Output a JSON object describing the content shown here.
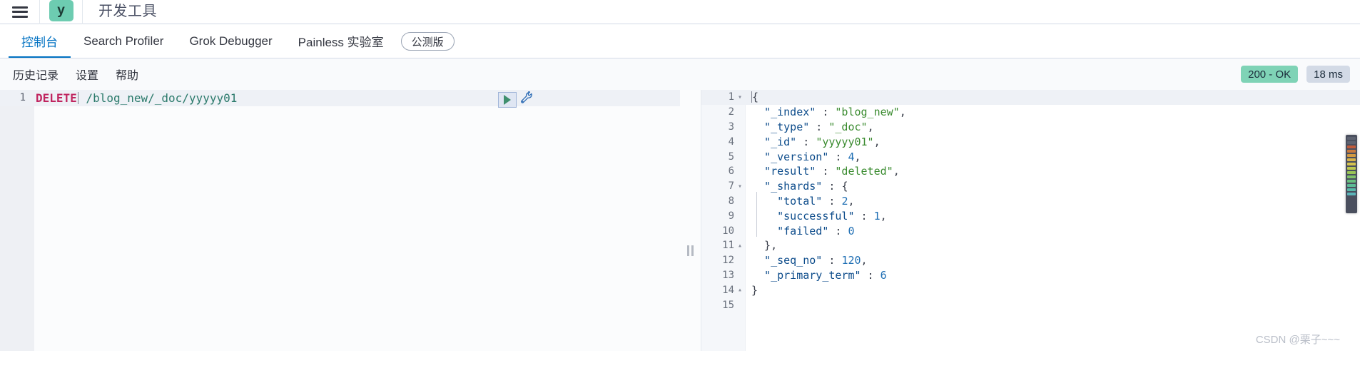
{
  "topbar": {
    "menu_icon": "hamburger-menu-icon",
    "logo_letter": "y",
    "app_title": "开发工具"
  },
  "tabs": [
    {
      "label": "控制台",
      "selected": true
    },
    {
      "label": "Search Profiler",
      "selected": false
    },
    {
      "label": "Grok Debugger",
      "selected": false
    },
    {
      "label": "Painless 实验室",
      "selected": false
    }
  ],
  "beta_badge": "公测版",
  "console_menu": [
    {
      "label": "历史记录"
    },
    {
      "label": "设置"
    },
    {
      "label": "帮助"
    }
  ],
  "status": {
    "code": "200 - OK",
    "time": "18 ms",
    "success_color": "#7fd3b6",
    "neutral_color": "#d3dae6"
  },
  "request": {
    "line_number": "1",
    "method": "DELETE",
    "path": " /blog_new/_doc/yyyyy01",
    "method_color": "#c0255f",
    "path_color": "#2b7a6b",
    "run_icon": "play-triangle-icon",
    "wrench_icon": "wrench-icon"
  },
  "response": {
    "lines": [
      {
        "n": "1",
        "fold": "▾",
        "segments": [
          {
            "t": "{",
            "c": "j-brace"
          }
        ]
      },
      {
        "n": "2",
        "fold": "",
        "segments": [
          {
            "t": "  \"_index\"",
            "c": "j-key"
          },
          {
            "t": " : ",
            "c": "j-punc"
          },
          {
            "t": "\"blog_new\"",
            "c": "j-str"
          },
          {
            "t": ",",
            "c": "j-punc"
          }
        ]
      },
      {
        "n": "3",
        "fold": "",
        "segments": [
          {
            "t": "  \"_type\"",
            "c": "j-key"
          },
          {
            "t": " : ",
            "c": "j-punc"
          },
          {
            "t": "\"_doc\"",
            "c": "j-str"
          },
          {
            "t": ",",
            "c": "j-punc"
          }
        ]
      },
      {
        "n": "4",
        "fold": "",
        "segments": [
          {
            "t": "  \"_id\"",
            "c": "j-key"
          },
          {
            "t": " : ",
            "c": "j-punc"
          },
          {
            "t": "\"yyyyy01\"",
            "c": "j-str"
          },
          {
            "t": ",",
            "c": "j-punc"
          }
        ]
      },
      {
        "n": "5",
        "fold": "",
        "segments": [
          {
            "t": "  \"_version\"",
            "c": "j-key"
          },
          {
            "t": " : ",
            "c": "j-punc"
          },
          {
            "t": "4",
            "c": "j-num"
          },
          {
            "t": ",",
            "c": "j-punc"
          }
        ]
      },
      {
        "n": "6",
        "fold": "",
        "segments": [
          {
            "t": "  \"result\"",
            "c": "j-key"
          },
          {
            "t": " : ",
            "c": "j-punc"
          },
          {
            "t": "\"deleted\"",
            "c": "j-str"
          },
          {
            "t": ",",
            "c": "j-punc"
          }
        ]
      },
      {
        "n": "7",
        "fold": "▾",
        "segments": [
          {
            "t": "  \"_shards\"",
            "c": "j-key"
          },
          {
            "t": " : ",
            "c": "j-punc"
          },
          {
            "t": "{",
            "c": "j-brace"
          }
        ]
      },
      {
        "n": "8",
        "fold": "",
        "segments": [
          {
            "t": "    \"total\"",
            "c": "j-key"
          },
          {
            "t": " : ",
            "c": "j-punc"
          },
          {
            "t": "2",
            "c": "j-num"
          },
          {
            "t": ",",
            "c": "j-punc"
          }
        ]
      },
      {
        "n": "9",
        "fold": "",
        "segments": [
          {
            "t": "    \"successful\"",
            "c": "j-key"
          },
          {
            "t": " : ",
            "c": "j-punc"
          },
          {
            "t": "1",
            "c": "j-num"
          },
          {
            "t": ",",
            "c": "j-punc"
          }
        ]
      },
      {
        "n": "10",
        "fold": "",
        "segments": [
          {
            "t": "    \"failed\"",
            "c": "j-key"
          },
          {
            "t": " : ",
            "c": "j-punc"
          },
          {
            "t": "0",
            "c": "j-num"
          }
        ]
      },
      {
        "n": "11",
        "fold": "▴",
        "segments": [
          {
            "t": "  },",
            "c": "j-brace"
          }
        ]
      },
      {
        "n": "12",
        "fold": "",
        "segments": [
          {
            "t": "  \"_seq_no\"",
            "c": "j-key"
          },
          {
            "t": " : ",
            "c": "j-punc"
          },
          {
            "t": "120",
            "c": "j-num"
          },
          {
            "t": ",",
            "c": "j-punc"
          }
        ]
      },
      {
        "n": "13",
        "fold": "",
        "segments": [
          {
            "t": "  \"_primary_term\"",
            "c": "j-key"
          },
          {
            "t": " : ",
            "c": "j-punc"
          },
          {
            "t": "6",
            "c": "j-num"
          }
        ]
      },
      {
        "n": "14",
        "fold": "▴",
        "segments": [
          {
            "t": "}",
            "c": "j-brace"
          }
        ]
      },
      {
        "n": "15",
        "fold": "",
        "segments": []
      }
    ]
  },
  "minimap": {
    "name": "code-minimap",
    "bars": [
      "#5d6270",
      "#5d6270",
      "#c05a3a",
      "#c97a3e",
      "#d39a42",
      "#d8b24a",
      "#d5c24f",
      "#bcc74f",
      "#9ac456",
      "#7fc268",
      "#68bf7f",
      "#5cbb95",
      "#57b8a8",
      "#5bb4b8"
    ]
  },
  "splitter": {
    "name": "pane-splitter"
  },
  "watermark": "CSDN @栗子~~~"
}
